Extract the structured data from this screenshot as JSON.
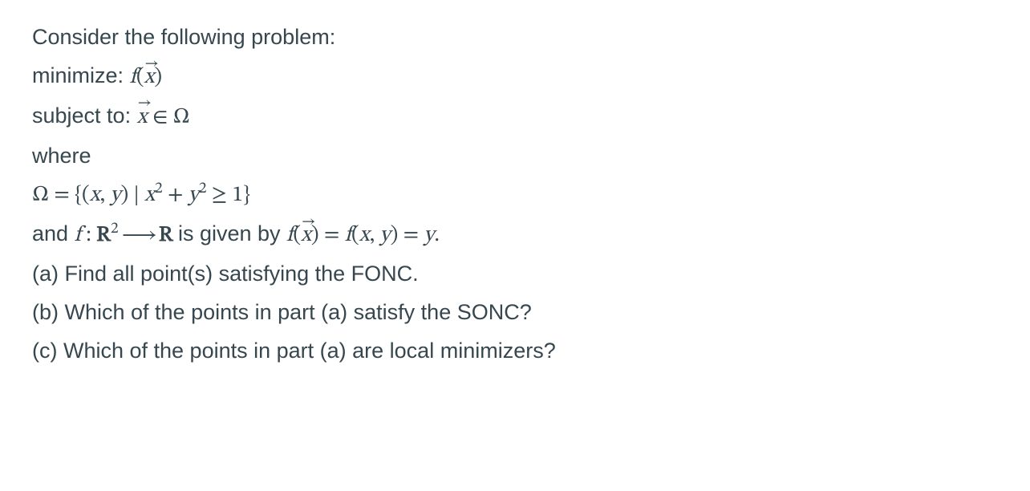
{
  "intro": "Consider the following problem:",
  "minimize_label": "minimize: ",
  "minimize_expr_f": "f",
  "minimize_expr_open": "(",
  "minimize_expr_x": "x",
  "minimize_expr_close": ")",
  "subject_label": "subject to: ",
  "subject_x": "x",
  "subject_in": " ∈ ",
  "subject_omega": "Ω",
  "where": "where",
  "omega_def_lhs": "Ω = {(",
  "omega_def_x": "x",
  "omega_def_comma1": ", ",
  "omega_def_y": "y",
  "omega_def_mid": ") | ",
  "omega_def_x2": "x",
  "omega_def_sup2a": "2",
  "omega_def_plus": " + ",
  "omega_def_y2": "y",
  "omega_def_sup2b": "2",
  "omega_def_geq": " ≥ 1}",
  "fdef_and": "and ",
  "fdef_f": "f",
  "fdef_colon": " : ",
  "fdef_R1": "R",
  "fdef_sup2": "2",
  "fdef_arrow": " ⟶ ",
  "fdef_R2": "R",
  "fdef_given": " is given by ",
  "fdef_fx_f": "f",
  "fdef_fx_open": "(",
  "fdef_fx_x": "x",
  "fdef_fx_close": ")",
  "fdef_eq1": " = ",
  "fdef_fxy_f": "f",
  "fdef_fxy_open": "(",
  "fdef_fxy_x": "x",
  "fdef_fxy_comma": ", ",
  "fdef_fxy_y": "y",
  "fdef_fxy_close": ")",
  "fdef_eq2": " = ",
  "fdef_rhs_y": "y",
  "fdef_period": ".",
  "part_a": "(a) Find all point(s) satisfying the FONC.",
  "part_b": "(b) Which of the points in part (a) satisfy the SONC?",
  "part_c": "(c) Which of the points in part (a) are local minimizers?"
}
